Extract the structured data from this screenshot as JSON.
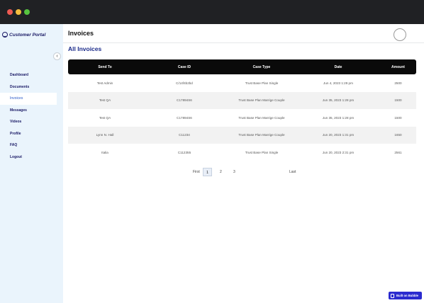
{
  "window": {
    "controls": [
      "close",
      "minimize",
      "maximize"
    ]
  },
  "brand": {
    "name": "Customer Portal",
    "icon": "smiley-icon"
  },
  "sidebar": {
    "collapse_icon": "chevron-left-icon",
    "items": [
      {
        "label": "Dashboard",
        "active": false
      },
      {
        "label": "Documents",
        "active": false
      },
      {
        "label": "Invoices",
        "active": true
      },
      {
        "label": "Messages",
        "active": false
      },
      {
        "label": "Videos",
        "active": false
      },
      {
        "label": "Profile",
        "active": false
      },
      {
        "label": "FAQ",
        "active": false
      },
      {
        "label": "Logout",
        "active": false
      }
    ]
  },
  "header": {
    "title": "Invoices",
    "avatar_icon": "avatar-icon"
  },
  "section": {
    "title": "All Invoices"
  },
  "table": {
    "columns": [
      "Send To",
      "Case ID",
      "Case Type",
      "Date",
      "Amount"
    ],
    "rows": [
      [
        "Test Admin",
        "C/14f4b2bd",
        "Trust Base Plan Single",
        "Jun 4, 2023 1:29 pm",
        "2500"
      ],
      [
        "Test QA",
        "C17894S6",
        "Trust Base Plan Marrige Couple",
        "Jun 35, 2023 1:28 pm",
        "1500"
      ],
      [
        "Test QA",
        "C17894S6",
        "Trust Base Plan Marrige Couple",
        "Jun 35, 2023 1:28 pm",
        "1500"
      ],
      [
        "Lynn N. Hall",
        "C11234",
        "Trust Base Plan Marrige Couple",
        "Jun 20, 2023 1:31 pm",
        "1650"
      ],
      [
        "Italia",
        "C112355",
        "Trust Base Plan Single",
        "Jun 20, 2023 2:31 pm",
        "2561"
      ]
    ]
  },
  "pagination": {
    "first": "First",
    "pages": [
      "1",
      "2",
      "3"
    ],
    "current": "1",
    "last": "Last"
  },
  "badge": {
    "label": "Built on Bubble",
    "icon": "bubble-icon"
  },
  "colors": {
    "titlebar": "#202124",
    "sidebar": "#eaf4fc",
    "brand": "#1a1a66",
    "table_header": "#0a0a0a",
    "accent": "#2b2bcf"
  }
}
